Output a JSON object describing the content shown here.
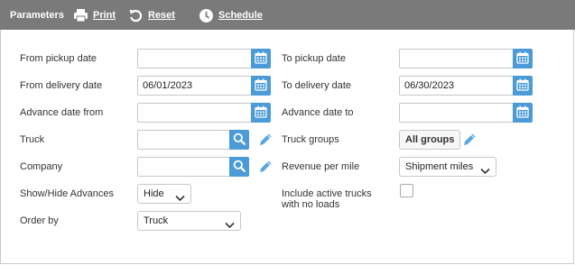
{
  "toolbar": {
    "title": "Parameters",
    "print_label": "Print",
    "reset_label": "Reset",
    "schedule_label": "Schedule"
  },
  "form": {
    "from_pickup_date": {
      "label": "From pickup date",
      "value": ""
    },
    "to_pickup_date": {
      "label": "To pickup date",
      "value": ""
    },
    "from_delivery_date": {
      "label": "From delivery date",
      "value": "06/01/2023"
    },
    "to_delivery_date": {
      "label": "To delivery date",
      "value": "06/30/2023"
    },
    "advance_date_from": {
      "label": "Advance date from",
      "value": ""
    },
    "advance_date_to": {
      "label": "Advance date to",
      "value": ""
    },
    "truck": {
      "label": "Truck",
      "value": ""
    },
    "truck_groups": {
      "label": "Truck groups",
      "button_label": "All groups"
    },
    "company": {
      "label": "Company",
      "value": ""
    },
    "revenue_per_mile": {
      "label": "Revenue per mile",
      "selected": "Shipment miles"
    },
    "show_hide_advances": {
      "label": "Show/Hide Advances",
      "selected": "Hide"
    },
    "include_active_trucks": {
      "label_line1": "Include active trucks",
      "label_line2": "with no loads",
      "checked": false
    },
    "order_by": {
      "label": "Order by",
      "selected": "Truck"
    }
  },
  "colors": {
    "toolbar_bg": "#7a7a7a",
    "accent": "#4a9bd8",
    "pencil": "#5aa6e0"
  },
  "icons": {
    "print": "printer-icon",
    "reset": "reset-icon",
    "schedule": "clock-icon",
    "date_picker": "calendar-icon",
    "lookup": "search-icon",
    "edit": "pencil-icon",
    "dropdown": "chevron-down-icon"
  }
}
